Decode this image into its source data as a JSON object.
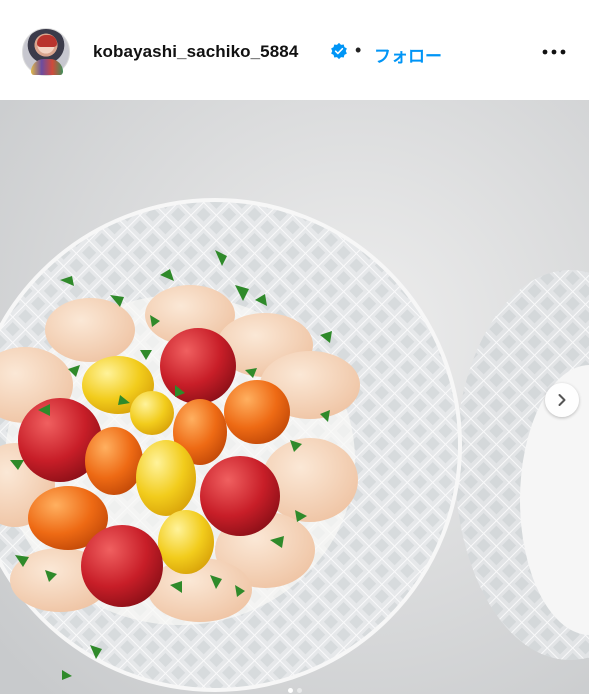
{
  "post": {
    "username": "kobayashi_sachiko_5884",
    "separator": "•",
    "follow_label": "フォロー",
    "verified": true,
    "carousel": {
      "current": 1,
      "total": 2
    }
  },
  "colors": {
    "accent": "#0095f6",
    "verified_badge": "#0095f6"
  },
  "icons": {
    "verified": "verified-badge-icon",
    "more": "more-options-icon",
    "next": "chevron-right-icon"
  }
}
